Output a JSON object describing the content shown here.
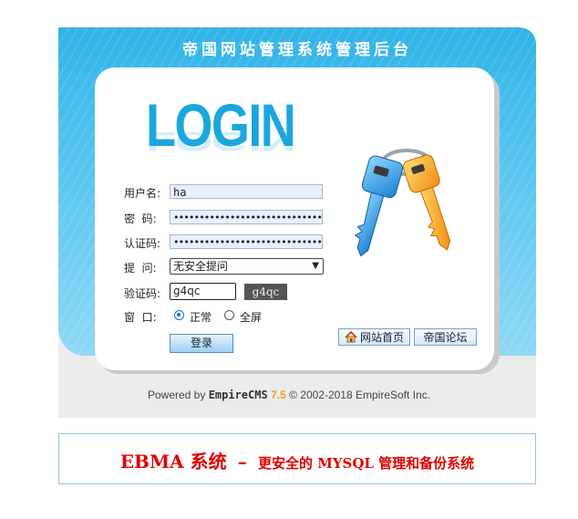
{
  "header": {
    "title": "帝国网站管理系统管理后台"
  },
  "logo": {
    "text": "LOGIN"
  },
  "form": {
    "username_label": "用户名:",
    "username_value": "ha",
    "password_label": "密  码:",
    "password_value": "••••••••••••••••••••••••••••••••",
    "auth_label": "认证码:",
    "auth_value": "••••••••••••••••••••••••••••••••",
    "question_label": "提  问:",
    "question_value": "无安全提问",
    "vcode_label": "验证码:",
    "vcode_value": "g4qc",
    "captcha_text": "g4qc",
    "window_label": "窗  口:",
    "window_options": [
      "正常",
      "全屏"
    ],
    "window_selected": "正常",
    "login_button": "登录"
  },
  "links": {
    "home_button": "网站首页",
    "forum_button": "帝国论坛"
  },
  "footer": {
    "powered": "Powered by",
    "brand": "EmpireCMS",
    "version": "7.5",
    "copyright": "© 2002-2018 EmpireSoft Inc."
  },
  "ad": {
    "title": "EBMA 系统",
    "dash": "–",
    "tagline": "更安全的 MYSQL 管理和备份系统"
  },
  "colors": {
    "accent": "#2fb3e8",
    "logo": "#1aa7dd",
    "ad_red": "#e00000",
    "version": "#f0a020"
  },
  "icons": [
    "home-icon",
    "keys-icon"
  ]
}
